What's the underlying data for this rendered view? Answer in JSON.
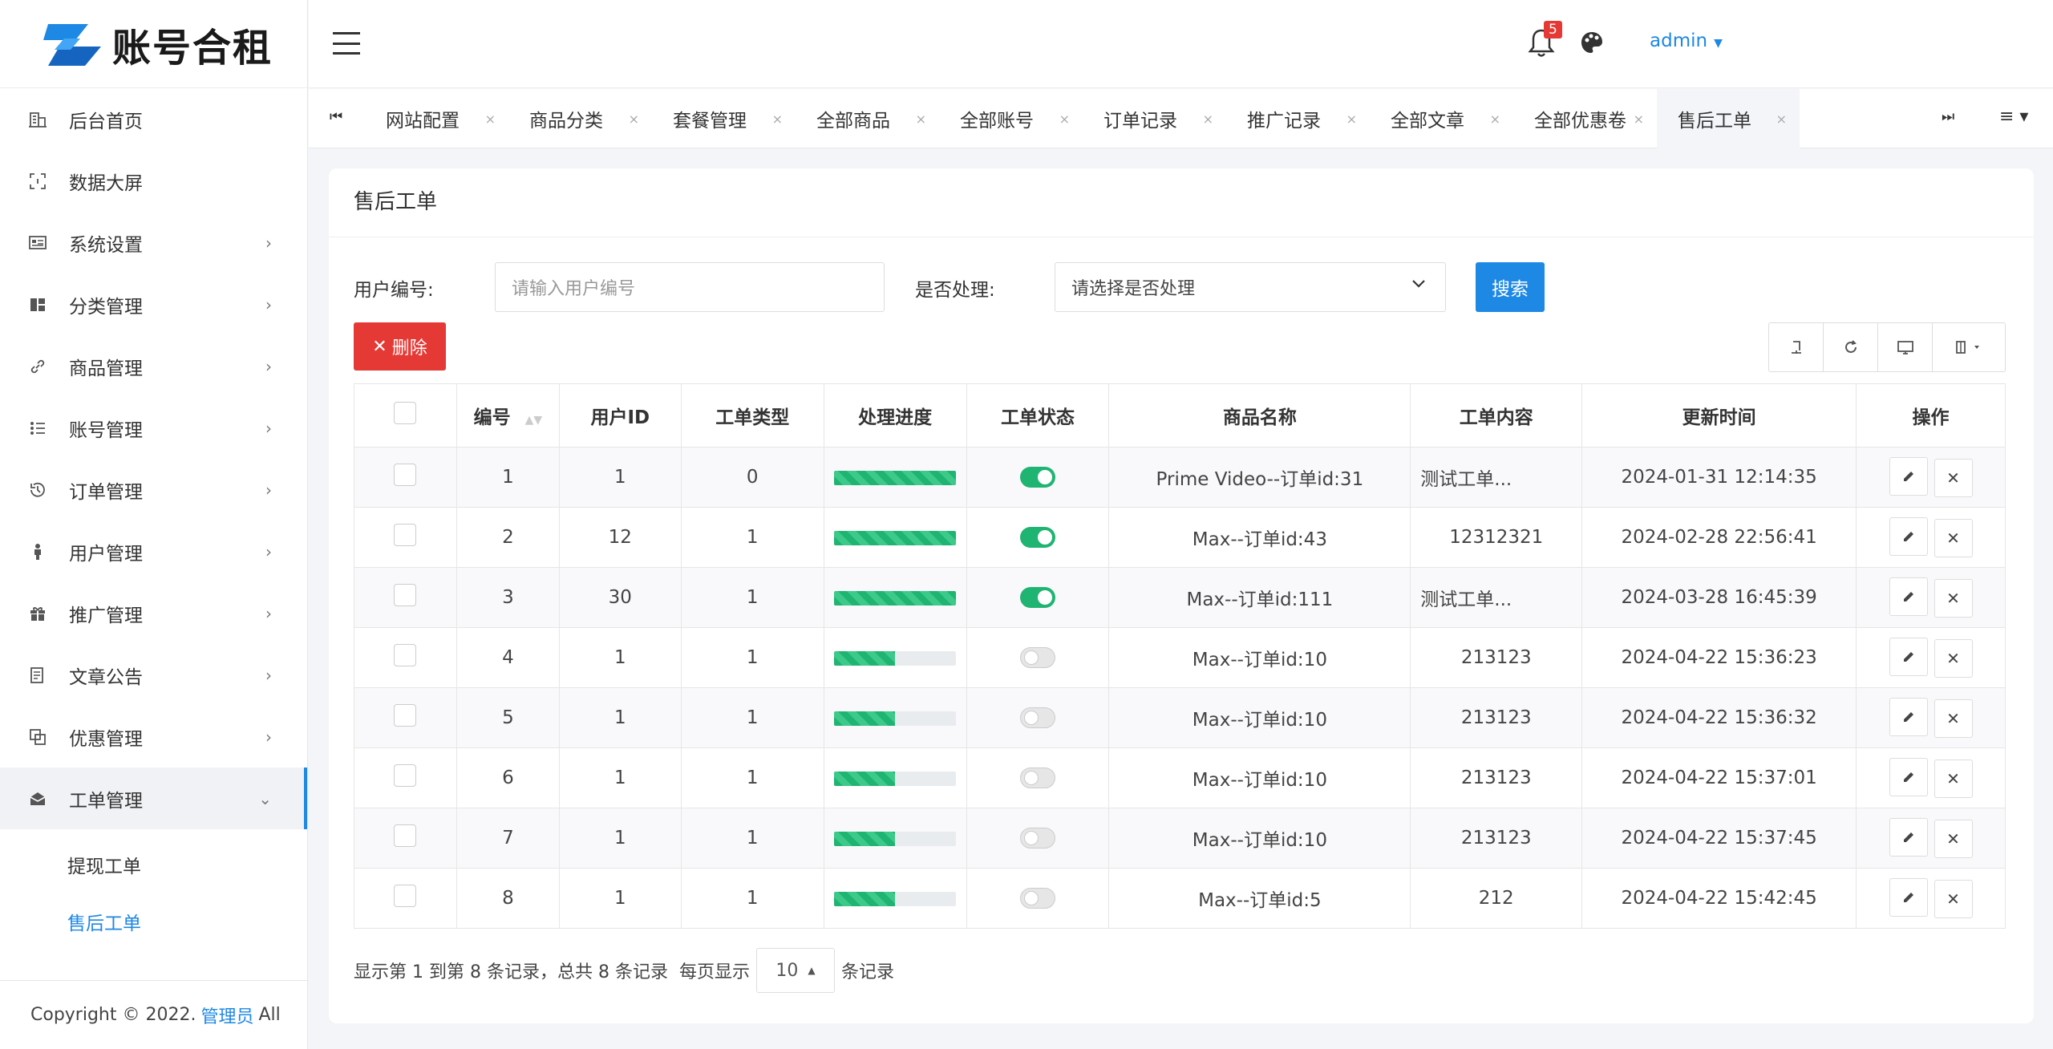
{
  "brand": {
    "name": "账号合租"
  },
  "sidebar": {
    "items": [
      {
        "label": "后台首页",
        "icon": "home-icon",
        "chevron": ""
      },
      {
        "label": "数据大屏",
        "icon": "screen-icon",
        "chevron": ""
      },
      {
        "label": "系统设置",
        "icon": "settings-icon",
        "chevron": "›"
      },
      {
        "label": "分类管理",
        "icon": "category-icon",
        "chevron": "›"
      },
      {
        "label": "商品管理",
        "icon": "link-icon",
        "chevron": "›"
      },
      {
        "label": "账号管理",
        "icon": "list-icon",
        "chevron": "›"
      },
      {
        "label": "订单管理",
        "icon": "history-icon",
        "chevron": "›"
      },
      {
        "label": "用户管理",
        "icon": "user-icon",
        "chevron": "›"
      },
      {
        "label": "推广管理",
        "icon": "gift-icon",
        "chevron": "›"
      },
      {
        "label": "文章公告",
        "icon": "article-icon",
        "chevron": "›"
      },
      {
        "label": "优惠管理",
        "icon": "coupon-icon",
        "chevron": "›"
      },
      {
        "label": "工单管理",
        "icon": "mail-icon",
        "chevron": "⌄"
      }
    ],
    "sub_items": [
      {
        "label": "提现工单",
        "active": false
      },
      {
        "label": "售后工单",
        "active": true
      }
    ],
    "copyright_prefix": "Copyright © 2022.",
    "copyright_link": "管理员",
    "copyright_suffix": "All"
  },
  "header": {
    "notification_count": "5",
    "user": "admin"
  },
  "tabs": [
    {
      "label": "网站配置"
    },
    {
      "label": "商品分类"
    },
    {
      "label": "套餐管理"
    },
    {
      "label": "全部商品"
    },
    {
      "label": "全部账号"
    },
    {
      "label": "订单记录"
    },
    {
      "label": "推广记录"
    },
    {
      "label": "全部文章"
    },
    {
      "label": "全部优惠卷"
    },
    {
      "label": "售后工单",
      "active": true
    }
  ],
  "page": {
    "title": "售后工单",
    "user_id_label": "用户编号:",
    "user_id_placeholder": "请输入用户编号",
    "handled_label": "是否处理:",
    "handled_placeholder": "请选择是否处理",
    "search_label": "搜索",
    "delete_label": "删除"
  },
  "table": {
    "headers": [
      "编号",
      "用户ID",
      "工单类型",
      "处理进度",
      "工单状态",
      "商品名称",
      "工单内容",
      "更新时间",
      "操作"
    ],
    "rows": [
      {
        "id": "1",
        "user_id": "1",
        "type": "0",
        "progress": 100,
        "status_on": true,
        "product": "Prime Video--订单id:31",
        "content": "测试工单...",
        "updated": "2024-01-31 12:14:35"
      },
      {
        "id": "2",
        "user_id": "12",
        "type": "1",
        "progress": 100,
        "status_on": true,
        "product": "Max--订单id:43",
        "content": "12312321",
        "updated": "2024-02-28 22:56:41"
      },
      {
        "id": "3",
        "user_id": "30",
        "type": "1",
        "progress": 100,
        "status_on": true,
        "product": "Max--订单id:111",
        "content": "测试工单...",
        "updated": "2024-03-28 16:45:39"
      },
      {
        "id": "4",
        "user_id": "1",
        "type": "1",
        "progress": 50,
        "status_on": false,
        "product": "Max--订单id:10",
        "content": "213123",
        "updated": "2024-04-22 15:36:23"
      },
      {
        "id": "5",
        "user_id": "1",
        "type": "1",
        "progress": 50,
        "status_on": false,
        "product": "Max--订单id:10",
        "content": "213123",
        "updated": "2024-04-22 15:36:32"
      },
      {
        "id": "6",
        "user_id": "1",
        "type": "1",
        "progress": 50,
        "status_on": false,
        "product": "Max--订单id:10",
        "content": "213123",
        "updated": "2024-04-22 15:37:01"
      },
      {
        "id": "7",
        "user_id": "1",
        "type": "1",
        "progress": 50,
        "status_on": false,
        "product": "Max--订单id:10",
        "content": "213123",
        "updated": "2024-04-22 15:37:45"
      },
      {
        "id": "8",
        "user_id": "1",
        "type": "1",
        "progress": 50,
        "status_on": false,
        "product": "Max--订单id:5",
        "content": "212",
        "updated": "2024-04-22 15:42:45"
      }
    ]
  },
  "pager": {
    "summary": "显示第 1 到第 8 条记录，总共 8 条记录",
    "per_page_label": "每页显示",
    "page_size": "10",
    "records_label": "条记录"
  },
  "colors": {
    "accent": "#1e88e5",
    "danger": "#e53935",
    "success": "#1fb472"
  }
}
